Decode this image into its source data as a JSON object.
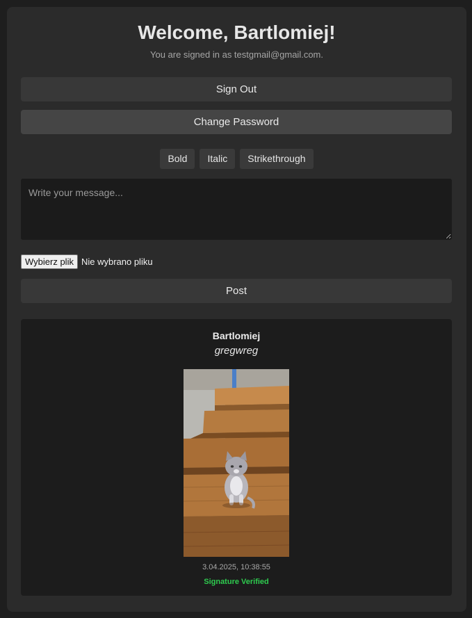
{
  "header": {
    "title": "Welcome, Bartlomiej!",
    "subtitle": "You are signed in as testgmail@gmail.com."
  },
  "account_actions": {
    "sign_out_label": "Sign Out",
    "change_password_label": "Change Password"
  },
  "format_toolbar": {
    "bold_label": "Bold",
    "italic_label": "Italic",
    "strikethrough_label": "Strikethrough"
  },
  "composer": {
    "message_placeholder": "Write your message...",
    "message_value": "",
    "file_button_label": "Wybierz plik",
    "file_status": "Nie wybrano pliku",
    "post_label": "Post"
  },
  "posts": [
    {
      "author": "Bartlomiej",
      "text": "gregwreg",
      "image_subject": "kitten-on-wooden-stairs-photo",
      "timestamp": "3.04.2025, 10:38:55",
      "signature_status": "Signature Verified"
    }
  ],
  "colors": {
    "background": "#1e1e1e",
    "panel": "#2b2b2b",
    "button": "#383838",
    "button_alt": "#454545",
    "post_card": "#1c1c1c",
    "verified_green": "#2ecc4f"
  }
}
